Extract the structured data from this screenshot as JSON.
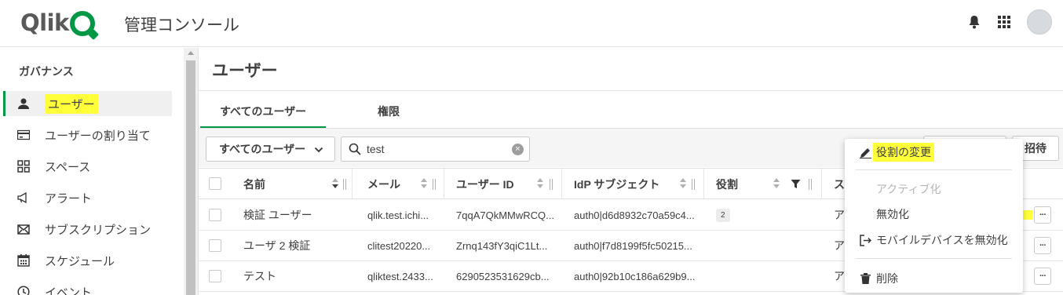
{
  "header": {
    "logo": "Qlik",
    "title": "管理コンソール",
    "icons": [
      "bell-icon",
      "grid-icon"
    ]
  },
  "sidebar": {
    "heading": "ガバナンス",
    "items": [
      {
        "label": "ユーザー",
        "icon": "user-icon",
        "active": true
      },
      {
        "label": "ユーザーの割り当て",
        "icon": "card-icon"
      },
      {
        "label": "スペース",
        "icon": "spaces-icon"
      },
      {
        "label": "アラート",
        "icon": "megaphone-icon"
      },
      {
        "label": "サブスクリプション",
        "icon": "mail-icon"
      },
      {
        "label": "スケジュール",
        "icon": "calendar-icon"
      },
      {
        "label": "イベント",
        "icon": "clock-icon"
      }
    ]
  },
  "main": {
    "title": "ユーザー",
    "tabs": [
      {
        "label": "すべてのユーザー",
        "active": true
      },
      {
        "label": "権限"
      }
    ],
    "filter_dropdown": "すべてのユーザー",
    "search_value": "test",
    "invite_label": "招待"
  },
  "table": {
    "columns": [
      "名前",
      "メール",
      "ユーザー ID",
      "IdP サブジェクト",
      "役割",
      "ス"
    ],
    "rows": [
      {
        "name": "検証 ユーザー",
        "email": "qlik.test.ichi...",
        "userid": "7qqA7QkMMwRCQ...",
        "idp": "auth0|d6d8932c70a59c4...",
        "role": "2",
        "status": "ア"
      },
      {
        "name": "ユーザ 2 検証",
        "email": "clitest20220...",
        "userid": "Zrnq143fY3qiC1Lt...",
        "idp": "auth0|f7d8199f5fc50215...",
        "role": "",
        "status": "ア"
      },
      {
        "name": "テスト",
        "email": "qliktest.2433...",
        "userid": "6290523531629cb...",
        "idp": "auth0|92b10c186a629b9...",
        "role": "",
        "status": "ア"
      }
    ],
    "more_label": "···"
  },
  "context_menu": {
    "items": [
      {
        "label": "役割の変更",
        "icon": "pencil-icon"
      },
      {
        "label": "アクティブ化",
        "disabled": true
      },
      {
        "label": "無効化"
      },
      {
        "label": "モバイルデバイスを無効化",
        "icon": "logout-icon"
      },
      {
        "label": "削除",
        "icon": "trash-icon"
      }
    ]
  },
  "colors": {
    "accent": "#009845",
    "highlight": "#ffff3a"
  }
}
